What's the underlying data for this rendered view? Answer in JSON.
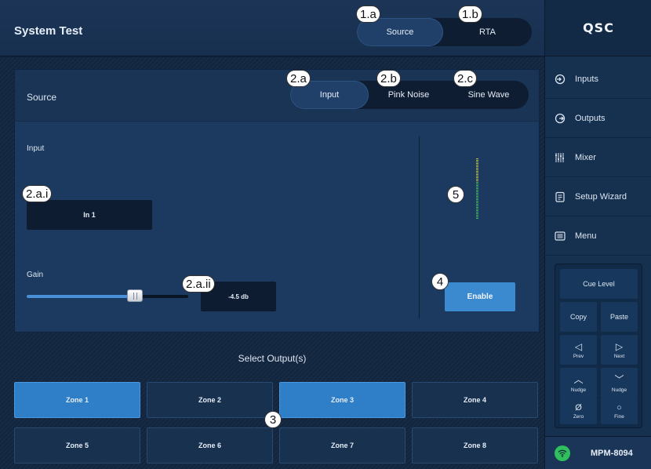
{
  "header": {
    "title": "System Test",
    "mode_tabs": [
      {
        "label": "Source",
        "active": true,
        "callout": "1.a"
      },
      {
        "label": "RTA",
        "active": false,
        "callout": "1.b"
      }
    ]
  },
  "source": {
    "title": "Source",
    "type_tabs": [
      {
        "label": "Input",
        "active": true,
        "callout": "2.a"
      },
      {
        "label": "Pink Noise",
        "active": false,
        "callout": "2.b"
      },
      {
        "label": "Sine Wave",
        "active": false,
        "callout": "2.c"
      }
    ],
    "input_label": "Input",
    "input_value": "In 1",
    "input_callout": "2.a.i",
    "gain_label": "Gain",
    "gain_value": "-4.5 db",
    "gain_position_fraction": 0.67,
    "gain_callout": "2.a.ii",
    "enable_label": "Enable",
    "enable_callout": "4",
    "meter_callout": "5"
  },
  "outputs": {
    "title": "Select Output(s)",
    "callout": "3",
    "zones": [
      {
        "label": "Zone 1",
        "selected": true
      },
      {
        "label": "Zone 2",
        "selected": false
      },
      {
        "label": "Zone 3",
        "selected": true
      },
      {
        "label": "Zone 4",
        "selected": false
      },
      {
        "label": "Zone 5",
        "selected": false
      },
      {
        "label": "Zone 6",
        "selected": false
      },
      {
        "label": "Zone 7",
        "selected": false
      },
      {
        "label": "Zone 8",
        "selected": false
      }
    ]
  },
  "sidebar": {
    "logo": "QSC",
    "items": [
      {
        "label": "Inputs",
        "icon": "input-icon"
      },
      {
        "label": "Outputs",
        "icon": "output-icon"
      },
      {
        "label": "Mixer",
        "icon": "mixer-icon"
      },
      {
        "label": "Setup Wizard",
        "icon": "wizard-icon"
      },
      {
        "label": "Menu",
        "icon": "menu-icon"
      }
    ],
    "pad": {
      "cue_level": "Cue Level",
      "copy": "Copy",
      "paste": "Paste",
      "prev": "Prev",
      "next": "Next",
      "nudge_up": "Nudge",
      "nudge_down": "Nudge",
      "zero": "Zero",
      "fine": "Fine",
      "prev_glyph": "◁",
      "next_glyph": "▷",
      "up_glyph": "︿",
      "down_glyph": "﹀",
      "zero_glyph": "Ø",
      "fine_glyph": "○"
    },
    "device_name": "MPM-8094"
  },
  "colors": {
    "accent": "#3b89cf",
    "wifi": "#2fbf5c",
    "background": "#0f2138"
  }
}
